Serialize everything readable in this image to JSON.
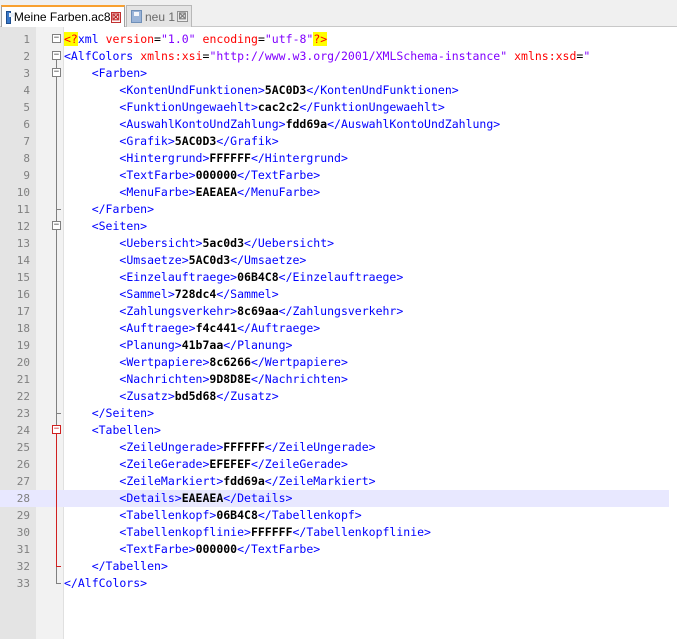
{
  "tabs": [
    {
      "label": "Meine Farben.ac8",
      "active": true,
      "icon": "saved-file-icon",
      "close": "⊠"
    },
    {
      "label": "neu 1",
      "active": false,
      "icon": "unsaved-file-icon",
      "close": "⊠"
    }
  ],
  "editor": {
    "current_line": 28,
    "decl": {
      "open": "<?",
      "name": "xml",
      "attr1": "version",
      "val1": "\"1.0\"",
      "attr2": "encoding",
      "val2": "\"utf-8\"",
      "close": "?>"
    },
    "root": {
      "open": "<AlfColors",
      "attr1": "xmlns:xsi",
      "eq": "=",
      "val1": "\"http://www.w3.org/2001/XMLSchema-instance\"",
      "attr2": "xmlns:xsd",
      "val2": "\""
    },
    "sections": [
      {
        "name": "Farben",
        "entries": [
          {
            "tag": "KontenUndFunktionen",
            "value": "5AC0D3"
          },
          {
            "tag": "FunktionUngewaehlt",
            "value": "cac2c2"
          },
          {
            "tag": "AuswahlKontoUndZahlung",
            "value": "fdd69a"
          },
          {
            "tag": "Grafik",
            "value": "5AC0D3"
          },
          {
            "tag": "Hintergrund",
            "value": "FFFFFF"
          },
          {
            "tag": "TextFarbe",
            "value": "000000"
          },
          {
            "tag": "MenuFarbe",
            "value": "EAEAEA"
          }
        ]
      },
      {
        "name": "Seiten",
        "entries": [
          {
            "tag": "Uebersicht",
            "value": "5ac0d3"
          },
          {
            "tag": "Umsaetze",
            "value": "5AC0d3"
          },
          {
            "tag": "Einzelauftraege",
            "value": "06B4C8"
          },
          {
            "tag": "Sammel",
            "value": "728dc4"
          },
          {
            "tag": "Zahlungsverkehr",
            "value": "8c69aa"
          },
          {
            "tag": "Auftraege",
            "value": "f4c441"
          },
          {
            "tag": "Planung",
            "value": "41b7aa"
          },
          {
            "tag": "Wertpapiere",
            "value": "8c6266"
          },
          {
            "tag": "Nachrichten",
            "value": "9D8D8E"
          },
          {
            "tag": "Zusatz",
            "value": "bd5d68"
          }
        ]
      },
      {
        "name": "Tabellen",
        "entries": [
          {
            "tag": "ZeileUngerade",
            "value": "FFFFFF"
          },
          {
            "tag": "ZeileGerade",
            "value": "EFEFEF"
          },
          {
            "tag": "ZeileMarkiert",
            "value": "fdd69a"
          },
          {
            "tag": "Details",
            "value": "EAEAEA"
          },
          {
            "tag": "Tabellenkopf",
            "value": "06B4C8"
          },
          {
            "tag": "Tabellenkopflinie",
            "value": "FFFFFF"
          },
          {
            "tag": "TextFarbe",
            "value": "000000"
          }
        ]
      }
    ],
    "root_close": "</AlfColors>"
  },
  "colors": {
    "tag": "#0000ff",
    "attribute": "#ff0000",
    "string": "#8000ff",
    "current_line": "#e8e8ff",
    "tab_accent": "#f8a030",
    "fold_active": "#d02020"
  }
}
